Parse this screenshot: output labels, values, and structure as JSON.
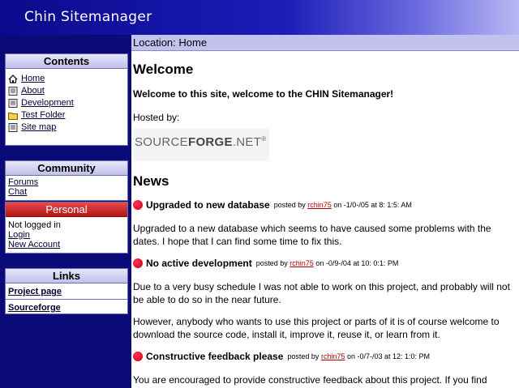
{
  "app": {
    "title": "Chin Sitemanager"
  },
  "location": "Location: Home",
  "sidebar": {
    "contents": {
      "title": "Contents",
      "items": [
        {
          "label": "Home",
          "icon": "home-icon"
        },
        {
          "label": "About",
          "icon": "page-icon"
        },
        {
          "label": "Development",
          "icon": "page-icon"
        },
        {
          "label": "Test Folder",
          "icon": "folder-icon"
        },
        {
          "label": "Site map",
          "icon": "page-icon"
        }
      ]
    },
    "community": {
      "title": "Community",
      "items": [
        "Forums",
        "Chat"
      ]
    },
    "personal": {
      "title": "Personal",
      "status": "Not logged in",
      "items": [
        "Login",
        "New Account"
      ]
    },
    "links": {
      "title": "Links",
      "items": [
        "Project page",
        "Sourceforge"
      ]
    }
  },
  "main": {
    "heading": "Welcome",
    "welcome_message": "Welcome to this site, welcome to the CHIN Sitemanager!",
    "hosted_by": "Hosted by:",
    "logo": {
      "part1": "SOURCE",
      "part2": "FORGE",
      "part3": ".NET",
      "mark": "®"
    },
    "news_heading": "News",
    "news": [
      {
        "title": "Upgraded to new database",
        "posted_by": "posted by",
        "author": "rchin75",
        "date": "on -1/0-/05 at 8: 1:5: AM",
        "paragraphs": [
          "Upgraded to a new database which seems to have caused some problems with the dates. I hope that I can find some time to fix this."
        ]
      },
      {
        "title": "No active development",
        "posted_by": "posted by",
        "author": "rchin75",
        "date": "on -0/9-/04 at 10: 0:1: PM",
        "paragraphs": [
          "Due to a very busy schedule I was not able to work on this project, and probably will not be able to do so in the near future.",
          "However, anybody who wants to use this project or parts of it is of course welcome to download the source code, install it, improve it, reuse it, or learn from it."
        ]
      },
      {
        "title": "Constructive feedback please",
        "posted_by": "posted by",
        "author": "rchin75",
        "date": "on -0/7-/03 at 12: 1:0: PM",
        "paragraphs": [
          "You are encouraged to provide constructive feedback about this project. If you find"
        ]
      }
    ]
  },
  "colors": {
    "navy": "#0a0a78",
    "header": "#1c1cb8",
    "location_bar": "#c2c2ee",
    "personal_header": "#c82020",
    "news_dot": "#dd0011"
  }
}
